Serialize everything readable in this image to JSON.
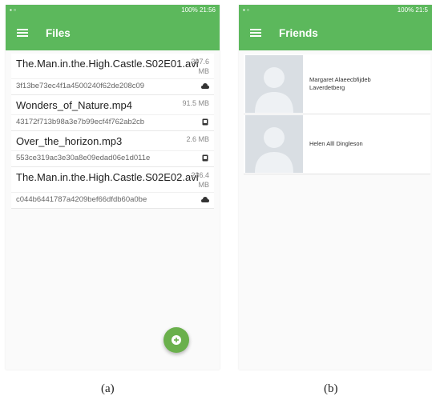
{
  "colors": {
    "primary": "#5cb85c",
    "fab": "#6ab04c"
  },
  "status_bar": {
    "left_icons": "▪ ▫",
    "right_text": "100%",
    "time": "21:56"
  },
  "screen_a": {
    "title": "Files",
    "files": [
      {
        "name": "The.Man.in.the.High.Castle.S02E01.avi",
        "size": "397.6 MB",
        "hash": "3f13be73ec4f1a4500240f62de208c09",
        "location": "cloud"
      },
      {
        "name": "Wonders_of_Nature.mp4",
        "size": "91.5 MB",
        "hash": "43172f713b98a3e7b99ecf4f762ab2cb",
        "location": "device"
      },
      {
        "name": "Over_the_horizon.mp3",
        "size": "2.6 MB",
        "hash": "553ce319ac3e30a8e09edad06e1d011e",
        "location": "device"
      },
      {
        "name": "The.Man.in.the.High.Castle.S02E02.avi",
        "size": "236.4 MB",
        "hash": "c044b6441787a4209bef66dfdb60a0be",
        "location": "cloud"
      }
    ]
  },
  "screen_b": {
    "title": "Friends",
    "time": "21:5",
    "friends": [
      {
        "name": "Margaret Alaeecbfijdeb Laverdetberg"
      },
      {
        "name": "Helen Alll Dingleson"
      }
    ]
  },
  "captions": {
    "a": "(a)",
    "b": "(b)"
  }
}
